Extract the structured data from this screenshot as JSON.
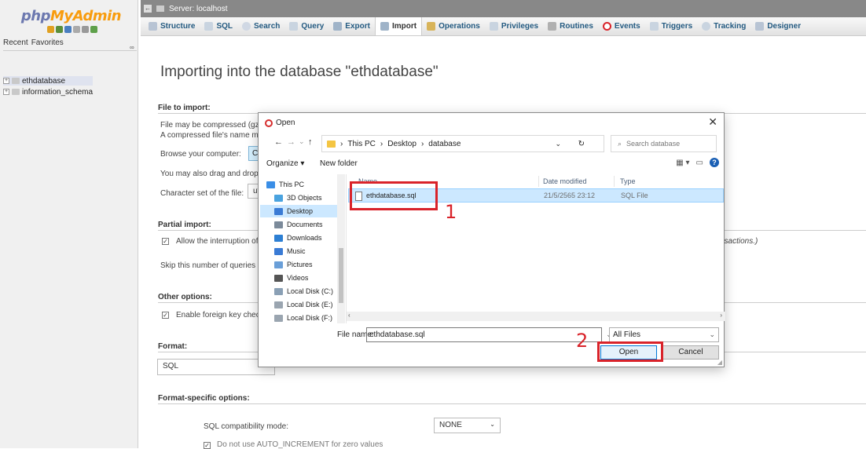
{
  "left_panel": {
    "logo_a": "php",
    "logo_b": "MyAdmin",
    "tab_recent": "Recent",
    "tab_favorites": "Favorites",
    "tree": [
      {
        "label": "ethdatabase"
      },
      {
        "label": "information_schema"
      }
    ]
  },
  "topbar": {
    "breadcrumb": "Server: localhost"
  },
  "tabs": [
    {
      "label": "Structure",
      "icon": "structure-icon"
    },
    {
      "label": "SQL",
      "icon": "sql-icon"
    },
    {
      "label": "Search",
      "icon": "search-icon"
    },
    {
      "label": "Query",
      "icon": "query-icon"
    },
    {
      "label": "Export",
      "icon": "export-icon"
    },
    {
      "label": "Import",
      "icon": "import-icon",
      "active": true
    },
    {
      "label": "Operations",
      "icon": "operations-icon"
    },
    {
      "label": "Privileges",
      "icon": "privileges-icon"
    },
    {
      "label": "Routines",
      "icon": "routines-icon"
    },
    {
      "label": "Events",
      "icon": "events-icon"
    },
    {
      "label": "Triggers",
      "icon": "triggers-icon"
    },
    {
      "label": "Tracking",
      "icon": "tracking-icon"
    },
    {
      "label": "Designer",
      "icon": "designer-icon"
    }
  ],
  "main": {
    "title": "Importing into the database \"ethdatabase\"",
    "file_to_import": {
      "heading": "File to import:",
      "compressed_note": "File may be compressed (gzip",
      "compressed_name_note": "A compressed file's name mu",
      "browse_label": "Browse your computer:",
      "choose_btn": "Ch",
      "drag_note": "You may also drag and drop a",
      "charset_label": "Character set of the file:",
      "charset_value": "ut"
    },
    "partial_import": {
      "heading": "Partial import:",
      "allow_interrupt": "Allow the interruption of a",
      "allow_interrupt_tail": "nsactions.)",
      "skip_queries": "Skip this number of queries (f"
    },
    "other_options": {
      "heading": "Other options:",
      "foreign_key": "Enable foreign key check"
    },
    "format": {
      "heading": "Format:",
      "value": "SQL"
    },
    "format_specific": {
      "heading": "Format-specific options:",
      "compat_label": "SQL compatibility mode:",
      "compat_value": "NONE",
      "auto_increment": "Do not use AUTO_INCREMENT for zero values"
    }
  },
  "dialog": {
    "title": "Open",
    "path": [
      "This PC",
      "Desktop",
      "database"
    ],
    "search_placeholder": "Search database",
    "organize": "Organize",
    "new_folder": "New folder",
    "nav_items": [
      {
        "label": "This PC",
        "color": "#3a8ee6"
      },
      {
        "label": "3D Objects",
        "color": "#4aa3df"
      },
      {
        "label": "Desktop",
        "color": "#3a7bd5",
        "selected": true
      },
      {
        "label": "Documents",
        "color": "#7b8a9a"
      },
      {
        "label": "Downloads",
        "color": "#2d7fd3"
      },
      {
        "label": "Music",
        "color": "#3a7bd5"
      },
      {
        "label": "Pictures",
        "color": "#6a9fd8"
      },
      {
        "label": "Videos",
        "color": "#555555"
      },
      {
        "label": "Local Disk (C:)",
        "color": "#8aa0b5"
      },
      {
        "label": "Local Disk (E:)",
        "color": "#9aa5b0"
      },
      {
        "label": "Local Disk (F:)",
        "color": "#9aa5b0"
      }
    ],
    "columns": {
      "name": "Name",
      "date": "Date modified",
      "type": "Type"
    },
    "files": [
      {
        "name": "ethdatabase.sql",
        "date": "21/5/2565 23:12",
        "type": "SQL File"
      }
    ],
    "file_name_label": "File name:",
    "file_name_value": "ethdatabase.sql",
    "filter": "All Files",
    "open_btn": "Open",
    "cancel_btn": "Cancel"
  },
  "annotations": {
    "step1": "1",
    "step2": "2"
  }
}
